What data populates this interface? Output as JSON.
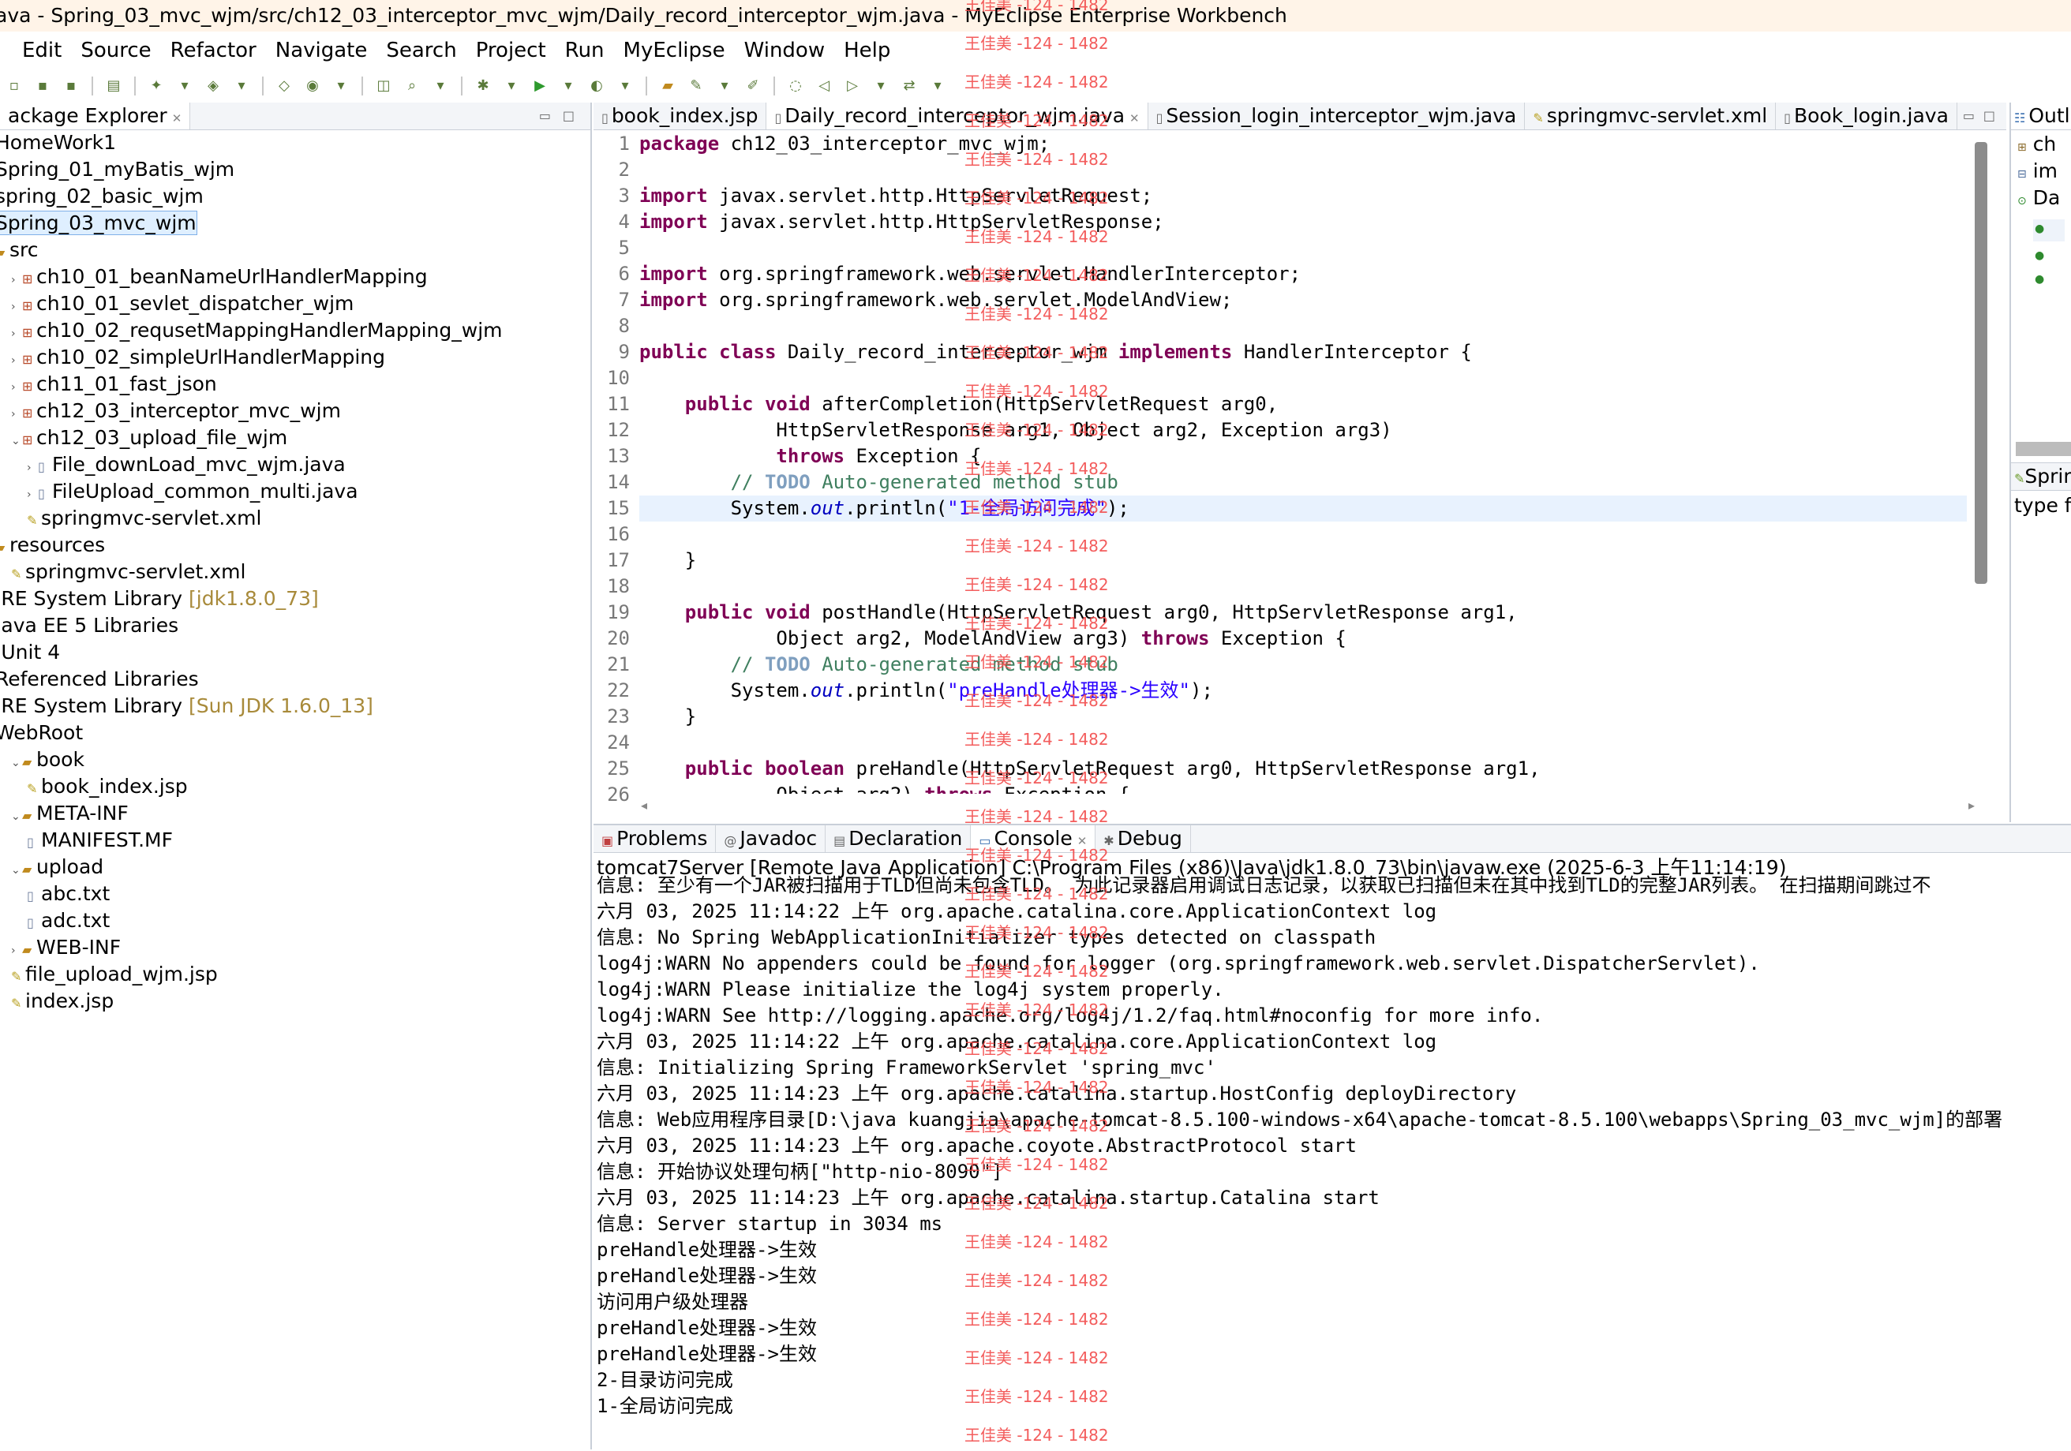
{
  "window": {
    "title": "ava - Spring_03_mvc_wjm/src/ch12_03_interceptor_mvc_wjm/Daily_record_interceptor_wjm.java - MyEclipse Enterprise Workbench"
  },
  "menu": [
    "Edit",
    "Source",
    "Refactor",
    "Navigate",
    "Search",
    "Project",
    "Run",
    "MyEclipse",
    "Window",
    "Help"
  ],
  "package_explorer": {
    "title": "ackage Explorer",
    "items": [
      {
        "label": "HomeWork1",
        "deco": ""
      },
      {
        "label": "Spring_01_myBatis_wjm",
        "deco": ""
      },
      {
        "label": "spring_02_basic_wjm",
        "deco": ""
      },
      {
        "label": "Spring_03_mvc_wjm",
        "deco": ""
      },
      {
        "label": "src",
        "deco": ""
      },
      {
        "label": "ch10_01_beanNameUrlHandlerMapping",
        "deco": ""
      },
      {
        "label": "ch10_01_sevlet_dispatcher_wjm",
        "deco": ""
      },
      {
        "label": "ch10_02_requsetMappingHandlerMapping_wjm",
        "deco": ""
      },
      {
        "label": "ch10_02_simpleUrlHandlerMapping",
        "deco": ""
      },
      {
        "label": "ch11_01_fast_json",
        "deco": ""
      },
      {
        "label": "ch12_03_interceptor_mvc_wjm",
        "deco": ""
      },
      {
        "label": "ch12_03_upload_file_wjm",
        "deco": ""
      },
      {
        "label": "File_downLoad_mvc_wjm.java",
        "deco": ""
      },
      {
        "label": "FileUpload_common_multi.java",
        "deco": ""
      },
      {
        "label": "springmvc-servlet.xml",
        "deco": ""
      },
      {
        "label": "resources",
        "deco": ""
      },
      {
        "label": "springmvc-servlet.xml",
        "deco": ""
      },
      {
        "label": "JRE System Library",
        "deco": "[jdk1.8.0_73]"
      },
      {
        "label": "Java EE 5 Libraries",
        "deco": ""
      },
      {
        "label": "JUnit 4",
        "deco": ""
      },
      {
        "label": "Referenced Libraries",
        "deco": ""
      },
      {
        "label": "JRE System Library",
        "deco": "[Sun JDK 1.6.0_13]"
      },
      {
        "label": "WebRoot",
        "deco": ""
      },
      {
        "label": "book",
        "deco": ""
      },
      {
        "label": "book_index.jsp",
        "deco": ""
      },
      {
        "label": "META-INF",
        "deco": ""
      },
      {
        "label": "MANIFEST.MF",
        "deco": ""
      },
      {
        "label": "upload",
        "deco": ""
      },
      {
        "label": "abc.txt",
        "deco": ""
      },
      {
        "label": "adc.txt",
        "deco": ""
      },
      {
        "label": "WEB-INF",
        "deco": ""
      },
      {
        "label": "file_upload_wjm.jsp",
        "deco": ""
      },
      {
        "label": "index.jsp",
        "deco": ""
      }
    ]
  },
  "editor": {
    "tabs": [
      "book_index.jsp",
      "Daily_record_interceptor_wjm.java",
      "Session_login_interceptor_wjm.java",
      "springmvc-servlet.xml",
      "Book_login.java"
    ],
    "line_numbers": [
      "1",
      "2",
      "3",
      "4",
      "5",
      "6",
      "7",
      "8",
      "9",
      "10",
      "11",
      "12",
      "13",
      "14",
      "15",
      "16",
      "17",
      "18",
      "19",
      "20",
      "21",
      "22",
      "23",
      "24",
      "25",
      "26"
    ],
    "code": {
      "l1_pkg_kw": "package",
      "l1_pkg_name": " ch12_03_interceptor_mvc_wjm;",
      "import_kw": "import",
      "l3_rest": " javax.servlet.http.HttpServletRequest;",
      "l4_rest": " javax.servlet.http.HttpServletResponse;",
      "l6_rest": " org.springframework.web.servlet.HandlerInterceptor;",
      "l7_rest": " org.springframework.web.servlet.ModelAndView;",
      "l9_public": "public",
      "l9_class": "class",
      "l9_name": " Daily_record_interceptor_wjm ",
      "l9_impl": "implements",
      "l9_rest": " HandlerInterceptor {",
      "l11_indent": "    ",
      "l11_public": "public",
      "l11_void": "void",
      "l11_rest": " afterCompletion(HttpServletRequest arg0,",
      "l12": "            HttpServletResponse arg1, Object arg2, Exception arg3)",
      "l13_indent": "            ",
      "l13_throws": "throws",
      "l13_rest": " Exception {",
      "l14_indent": "        ",
      "l14_cm1": "// ",
      "l14_todo": "TODO",
      "l14_cm2": " Auto-generated method stub",
      "l15_pre": "        System.",
      "l15_out": "out",
      "l15_mid": ".println(",
      "l15_str": "\"1-全局访问完成\"",
      "l15_end": ");",
      "l17": "    }",
      "l19_rest": " postHandle(HttpServletRequest arg0, HttpServletResponse arg1,",
      "l20_pre": "            Object arg2, ModelAndView arg3) ",
      "l20_throws": "throws",
      "l20_rest": " Exception {",
      "l22_str": "\"preHandle处理器->生效\"",
      "l23": "    }",
      "l25_boolean": "boolean",
      "l25_rest": " preHandle(HttpServletRequest arg0, HttpServletResponse arg1,",
      "l26_pre": "            Object arg2) ",
      "l26_throws": "throws",
      "l26_rest": " Exception {"
    }
  },
  "outline": {
    "title": "Outli",
    "items": [
      "ch",
      "im",
      "Da"
    ],
    "second_title": "Sprin",
    "second_text": "type fi"
  },
  "console": {
    "tabs": [
      "Problems",
      "Javadoc",
      "Declaration",
      "Console",
      "Debug"
    ],
    "header": "tomcat7Server [Remote Java Application] C:\\Program Files (x86)\\Java\\jdk1.8.0_73\\bin\\javaw.exe (2025-6-3 上午11:14:19)",
    "lines": [
      "信息: 至少有一个JAR被扫描用于TLD但尚未包含TLD。 为此记录器启用调试日志记录，以获取已扫描但未在其中找到TLD的完整JAR列表。 在扫描期间跳过不",
      "六月 03, 2025 11:14:22 上午 org.apache.catalina.core.ApplicationContext log",
      "信息: No Spring WebApplicationInitializer types detected on classpath",
      "log4j:WARN No appenders could be found for logger (org.springframework.web.servlet.DispatcherServlet).",
      "log4j:WARN Please initialize the log4j system properly.",
      "log4j:WARN See http://logging.apache.org/log4j/1.2/faq.html#noconfig for more info.",
      "六月 03, 2025 11:14:22 上午 org.apache.catalina.core.ApplicationContext log",
      "信息: Initializing Spring FrameworkServlet 'spring_mvc'",
      "六月 03, 2025 11:14:23 上午 org.apache.catalina.startup.HostConfig deployDirectory",
      "信息: Web应用程序目录[D:\\java kuangjia\\apache-tomcat-8.5.100-windows-x64\\apache-tomcat-8.5.100\\webapps\\Spring_03_mvc_wjm]的部署",
      "六月 03, 2025 11:14:23 上午 org.apache.coyote.AbstractProtocol start",
      "信息: 开始协议处理句柄[\"http-nio-8090\"]",
      "六月 03, 2025 11:14:23 上午 org.apache.catalina.startup.Catalina start",
      "信息: Server startup in 3034 ms",
      "preHandle处理器->生效",
      "preHandle处理器->生效",
      "访问用户级处理器",
      "preHandle处理器->生效",
      "preHandle处理器->生效",
      "2-目录访问完成",
      "1-全局访问完成"
    ]
  },
  "watermark": {
    "text": "王佳美 -124 - 1482",
    "color": "#f24b4b"
  }
}
